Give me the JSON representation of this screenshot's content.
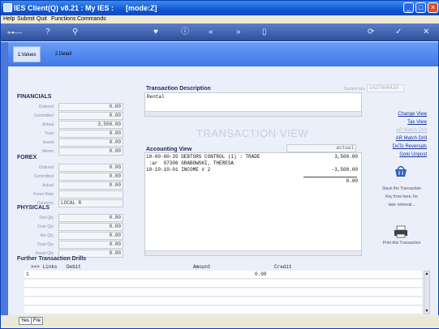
{
  "window": {
    "title": "IES Client(Q) v8.21 : My IES :      [mode:Z]"
  },
  "menu": [
    "Help",
    "Submit",
    "Quit",
    "Functions",
    "Commands"
  ],
  "toolbar_icons": [
    "back-key-icon",
    "help-icon",
    "search-icon",
    "heart-icon",
    "info-icon",
    "rewind-icon",
    "fast-forward-icon",
    "stop-icon",
    "sync-icon",
    "check-icon",
    "close-icon"
  ],
  "tabs": [
    {
      "label": "1.Values",
      "active": true
    },
    {
      "label": "2.Detail",
      "active": false
    }
  ],
  "system_key": {
    "label": "System key",
    "value": "1427946420"
  },
  "transaction": {
    "desc_label": "Transaction Description",
    "desc_value": "Rental",
    "watermark": "TRANSACTION VIEW"
  },
  "financials": {
    "title": "FINANCIALS",
    "rows": [
      {
        "label": "Ordered",
        "value": "0.00"
      },
      {
        "label": "Committed",
        "value": "0.00"
      },
      {
        "label": "Actual",
        "value": "3,500.00"
      },
      {
        "label": "Trust",
        "value": "0.00"
      },
      {
        "label": "Invest",
        "value": "0.00"
      },
      {
        "label": "Memo",
        "value": "0.00"
      }
    ]
  },
  "forex": {
    "title": "FOREX",
    "rows": [
      {
        "label": "Ordered",
        "value": "0.00"
      },
      {
        "label": "Committed",
        "value": "0.00"
      },
      {
        "label": "Actual",
        "value": "0.00"
      },
      {
        "label": "Forex Rate",
        "value": ""
      },
      {
        "label": "Currency",
        "value": "LOCAL R"
      }
    ]
  },
  "physicals": {
    "title": "PHYSICALS",
    "rows": [
      {
        "label": "Ord Qty",
        "value": "0.00"
      },
      {
        "label": "Com Qty",
        "value": "0.00"
      },
      {
        "label": "Act Qty",
        "value": "0.00"
      },
      {
        "label": "Trust Qty",
        "value": "0.00"
      },
      {
        "label": "Invest Qty",
        "value": "0.00"
      }
    ]
  },
  "accounting": {
    "title": "Accounting View",
    "column": "actual",
    "lines": [
      {
        "text": "10-00-00-35 DEBTORS CONTROL (1) : TRADE",
        "amount": "3,500.00"
      },
      {
        "text": " :ar  07306 GRABOWSKI, THERESA",
        "amount": ""
      },
      {
        "text": "10-10-10-01 INCOME # 2",
        "amount": "-3,500.00"
      }
    ],
    "total": "0.00"
  },
  "side_links": [
    {
      "label": "Change View",
      "enabled": true
    },
    {
      "label": "Tax View",
      "enabled": true
    },
    {
      "label": "AP Match Drill",
      "enabled": false
    },
    {
      "label": "AR Match Drill",
      "enabled": true
    },
    {
      "label": "DoTo Reversals",
      "enabled": true
    },
    {
      "label": "Goto Unpost",
      "enabled": true
    }
  ],
  "stack_hint": [
    "Stack the Transaction",
    "Key from here, for",
    "later retrieval..."
  ],
  "print_hint": "Print this Transaction",
  "drills": {
    "title": "Further Transaction Drills",
    "headers": [
      ">>> Links",
      "Debit",
      "Amount",
      "Credit"
    ],
    "row": {
      "index": "1",
      "amount": "0.00"
    }
  },
  "status_buttons": [
    "Yes",
    "Fre"
  ]
}
